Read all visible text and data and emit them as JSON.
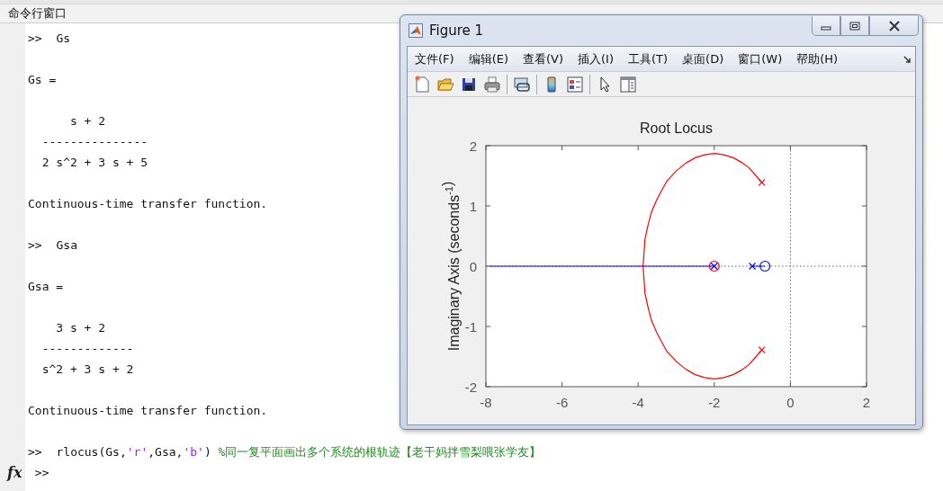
{
  "command_window": {
    "title": "命令行窗口",
    "lines": [
      {
        "kind": "input",
        "prompt": ">>",
        "segments": [
          {
            "kind": "code",
            "text": "Gs"
          }
        ]
      },
      {
        "kind": "blank"
      },
      {
        "kind": "output",
        "text": "Gs ="
      },
      {
        "kind": "blank"
      },
      {
        "kind": "output",
        "text": "      s + 2"
      },
      {
        "kind": "output",
        "text": "  ---------------"
      },
      {
        "kind": "output",
        "text": "  2 s^2 + 3 s + 5"
      },
      {
        "kind": "blank"
      },
      {
        "kind": "output",
        "text": "Continuous-time transfer function."
      },
      {
        "kind": "blank"
      },
      {
        "kind": "input",
        "prompt": ">>",
        "segments": [
          {
            "kind": "code",
            "text": "Gsa"
          }
        ]
      },
      {
        "kind": "blank"
      },
      {
        "kind": "output",
        "text": "Gsa ="
      },
      {
        "kind": "blank"
      },
      {
        "kind": "output",
        "text": "    3 s + 2"
      },
      {
        "kind": "output",
        "text": "  -------------"
      },
      {
        "kind": "output",
        "text": "  s^2 + 3 s + 2"
      },
      {
        "kind": "blank"
      },
      {
        "kind": "output",
        "text": "Continuous-time transfer function."
      },
      {
        "kind": "blank"
      },
      {
        "kind": "input",
        "prompt": ">>",
        "segments": [
          {
            "kind": "code",
            "text": "rlocus(Gs,"
          },
          {
            "kind": "string",
            "text": "'r'"
          },
          {
            "kind": "code",
            "text": ",Gsa,"
          },
          {
            "kind": "string",
            "text": "'b'"
          },
          {
            "kind": "code",
            "text": ") "
          },
          {
            "kind": "comment",
            "text": "%同一复平面画出多个系统的根轨迹【老干妈拌雪梨喂张学友】"
          }
        ]
      },
      {
        "kind": "current",
        "prompt": ">>",
        "function_button": "fx"
      }
    ]
  },
  "figure": {
    "title": "Figure 1",
    "menu": [
      "文件(F)",
      "编辑(E)",
      "查看(V)",
      "插入(I)",
      "工具(T)",
      "桌面(D)",
      "窗口(W)",
      "帮助(H)"
    ],
    "toolbar": [
      {
        "kind": "new"
      },
      {
        "kind": "open"
      },
      {
        "kind": "save"
      },
      {
        "kind": "print"
      },
      {
        "kind": "separator"
      },
      {
        "kind": "link"
      },
      {
        "kind": "separator"
      },
      {
        "kind": "colorbar"
      },
      {
        "kind": "legend"
      },
      {
        "kind": "separator"
      },
      {
        "kind": "pointer"
      },
      {
        "kind": "inspector"
      }
    ],
    "chart_data": {
      "type": "line",
      "title": "Root Locus",
      "ylabel": "Imaginary Axis (seconds$^{-1}$)",
      "xlim": [
        -8,
        2
      ],
      "ylim": [
        -2,
        2
      ],
      "xticks": [
        -8,
        -6,
        -4,
        -2,
        0,
        2
      ],
      "yticks": [
        -2,
        -1,
        0,
        1,
        2
      ],
      "series": [
        {
          "color": "#ff0000",
          "x": [
            -0.75,
            -0.9,
            -1.1,
            -1.3,
            -1.5,
            -1.75,
            -2,
            -2.25,
            -2.5,
            -2.75,
            -3,
            -3.25,
            -3.5,
            -3.65,
            -3.75,
            -3.82,
            -3.87,
            -3.82,
            -3.75,
            -3.65,
            -3.5,
            -3.25,
            -3,
            -2.75,
            -2.5,
            -2.25,
            -2,
            -1.75,
            -1.5,
            -1.3,
            -1.1,
            -0.9,
            -0.75
          ],
          "values": [
            1.39,
            1.5,
            1.64,
            1.73,
            1.8,
            1.85,
            1.87,
            1.85,
            1.8,
            1.71,
            1.58,
            1.41,
            1.12,
            0.9,
            0.66,
            0.45,
            0,
            -0.45,
            -0.66,
            -0.9,
            -1.12,
            -1.41,
            -1.58,
            -1.71,
            -1.8,
            -1.85,
            -1.87,
            -1.85,
            -1.8,
            -1.73,
            -1.64,
            -1.5,
            -1.39
          ]
        },
        {
          "color": "#0000ff",
          "x": [
            -7.9,
            -2,
            null,
            -1,
            -0.667
          ],
          "values": [
            0,
            0,
            null,
            0,
            0
          ]
        },
        {
          "type": "scatter",
          "color": "#ff0000",
          "marker": "cross",
          "x": [
            -0.75,
            -0.75
          ],
          "values": [
            1.39,
            -1.39
          ]
        },
        {
          "type": "scatter",
          "color": "#ff0000",
          "marker": "circle",
          "x": [
            -2
          ],
          "values": [
            0
          ]
        },
        {
          "type": "scatter",
          "color": "#0000ff",
          "marker": "cross",
          "x": [
            -2,
            -1
          ],
          "values": [
            0,
            0
          ]
        },
        {
          "type": "scatter",
          "color": "#0000ff",
          "marker": "circle",
          "x": [
            -0.667
          ],
          "values": [
            0
          ]
        }
      ]
    }
  }
}
